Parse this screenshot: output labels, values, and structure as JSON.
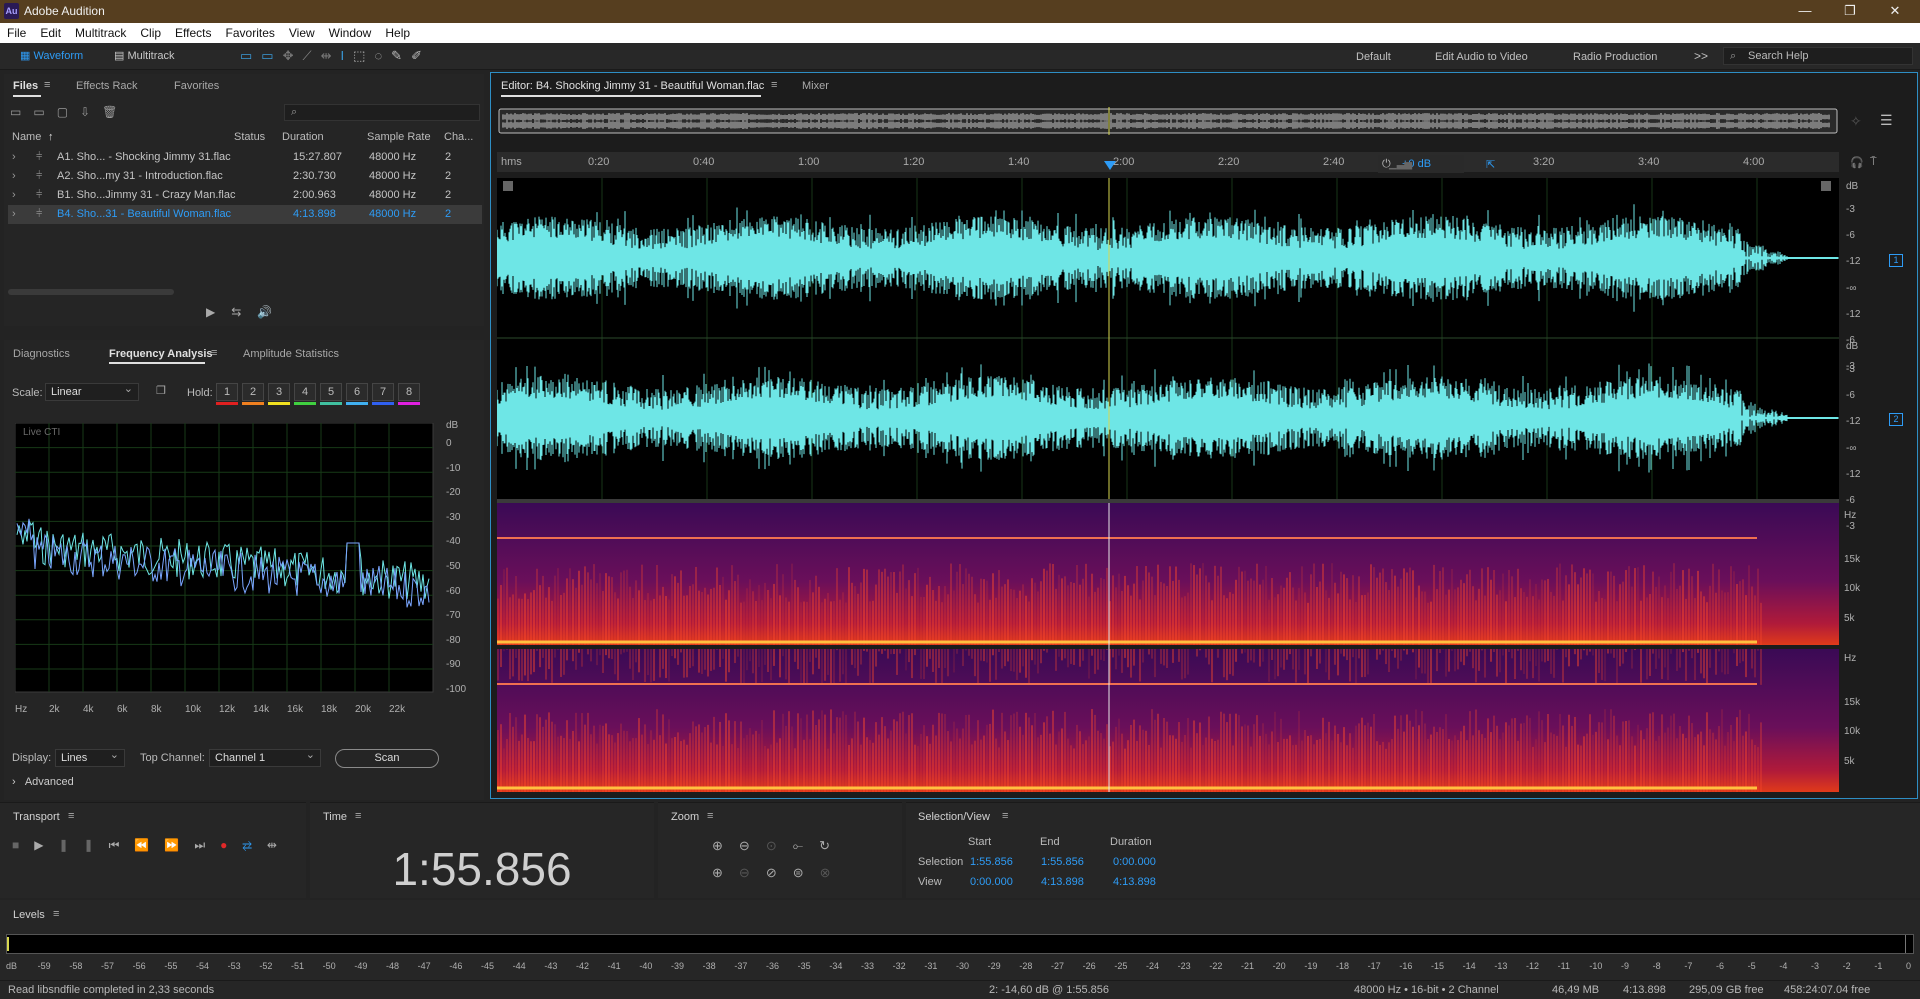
{
  "app": {
    "title": "Adobe Audition",
    "logo": "Au"
  },
  "menu": [
    "File",
    "Edit",
    "Multitrack",
    "Clip",
    "Effects",
    "Favorites",
    "View",
    "Window",
    "Help"
  ],
  "toolbar": {
    "waveform": "Waveform",
    "multitrack": "Multitrack",
    "workspaces": [
      "Default",
      "Edit Audio to Video",
      "Radio Production"
    ],
    "more": ">>",
    "search_placeholder": "Search Help"
  },
  "files": {
    "tabs": [
      "Files",
      "Effects Rack",
      "Favorites"
    ],
    "columns": [
      "Name",
      "Status",
      "Duration",
      "Sample Rate",
      "Cha..."
    ],
    "rows": [
      {
        "name": "A1. Sho... - Shocking Jimmy 31.flac",
        "duration": "15:27.807",
        "rate": "48000 Hz",
        "ch": "2",
        "selected": false
      },
      {
        "name": "A2. Sho...my 31 - Introduction.flac",
        "duration": "2:30.730",
        "rate": "48000 Hz",
        "ch": "2",
        "selected": false
      },
      {
        "name": "B1. Sho...Jimmy 31 - Crazy Man.flac",
        "duration": "2:00.963",
        "rate": "48000 Hz",
        "ch": "2",
        "selected": false
      },
      {
        "name": "B4. Sho...31 - Beautiful Woman.flac",
        "duration": "4:13.898",
        "rate": "48000 Hz",
        "ch": "2",
        "selected": true
      }
    ]
  },
  "analysis": {
    "tabs": [
      "Diagnostics",
      "Frequency Analysis",
      "Amplitude Statistics"
    ],
    "scale_label": "Scale:",
    "scale_value": "Linear",
    "hold_label": "Hold:",
    "holds": [
      "1",
      "2",
      "3",
      "4",
      "5",
      "6",
      "7",
      "8"
    ],
    "hold_colors": [
      "#e02020",
      "#f08020",
      "#f0e020",
      "#40d040",
      "#40c0a0",
      "#40b0f0",
      "#3060f0",
      "#e020e0"
    ],
    "live": "Live CTI",
    "db_label": "dB",
    "db_ticks": [
      "0",
      "-10",
      "-20",
      "-30",
      "-40",
      "-50",
      "-60",
      "-70",
      "-80",
      "-90",
      "-100"
    ],
    "hz_ticks": [
      "Hz",
      "2k",
      "4k",
      "6k",
      "8k",
      "10k",
      "12k",
      "14k",
      "16k",
      "18k",
      "20k",
      "22k"
    ],
    "display_label": "Display:",
    "display_value": "Lines",
    "topch_label": "Top Channel:",
    "topch_value": "Channel 1",
    "scan": "Scan",
    "advanced": "Advanced"
  },
  "editor": {
    "tab": "Editor: B4. Shocking Jimmy 31 - Beautiful Woman.flac",
    "mixer": "Mixer",
    "ruler": [
      "hms",
      "0:20",
      "0:40",
      "1:00",
      "1:20",
      "1:40",
      "2:00",
      "2:20",
      "2:40",
      "3:00",
      "3:20",
      "3:40",
      "4:00"
    ],
    "gain": "+0 dB",
    "wave_db": [
      "dB",
      "-3",
      "-6",
      "-12",
      "-∞",
      "-12",
      "-6",
      "-3"
    ],
    "channels": [
      "1",
      "2"
    ],
    "spec_hz": [
      "Hz",
      "15k",
      "10k",
      "5k"
    ]
  },
  "transport": {
    "title": "Transport",
    "time_title": "Time",
    "time": "1:55.856"
  },
  "zoom": {
    "title": "Zoom"
  },
  "selection": {
    "title": "Selection/View",
    "cols": [
      "Start",
      "End",
      "Duration"
    ],
    "selection_label": "Selection",
    "view_label": "View",
    "selection": [
      "1:55.856",
      "1:55.856",
      "0:00.000"
    ],
    "view": [
      "0:00.000",
      "4:13.898",
      "4:13.898"
    ]
  },
  "levels": {
    "title": "Levels",
    "ticks": [
      "dB",
      "-59",
      "-58",
      "-57",
      "-56",
      "-55",
      "-54",
      "-53",
      "-52",
      "-51",
      "-50",
      "-49",
      "-48",
      "-47",
      "-46",
      "-45",
      "-44",
      "-43",
      "-42",
      "-41",
      "-40",
      "-39",
      "-38",
      "-37",
      "-36",
      "-35",
      "-34",
      "-33",
      "-32",
      "-31",
      "-30",
      "-29",
      "-28",
      "-27",
      "-26",
      "-25",
      "-24",
      "-23",
      "-22",
      "-21",
      "-20",
      "-19",
      "-18",
      "-17",
      "-16",
      "-15",
      "-14",
      "-13",
      "-12",
      "-11",
      "-10",
      "-9",
      "-8",
      "-7",
      "-6",
      "-5",
      "-4",
      "-3",
      "-2",
      "-1",
      "0"
    ]
  },
  "status": {
    "message": "Read libsndfile completed in 2,33 seconds",
    "cursor": "2: -14,60 dB @ 1:55.856",
    "format": "48000 Hz • 16-bit • 2 Channel",
    "size": "46,49 MB",
    "duration": "4:13.898",
    "free": "295,09 GB free",
    "free_time": "458:24:07.04 free"
  },
  "colors": {
    "accent": "#2e9cf6",
    "waveform": "#6ee6e6",
    "playhead": "#d8d850",
    "title_bg": "#563e1f"
  }
}
